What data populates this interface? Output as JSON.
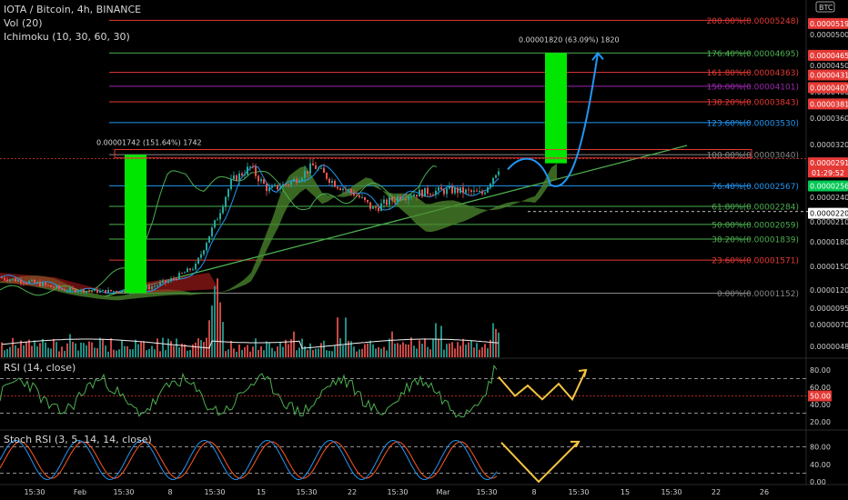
{
  "header": {
    "symbol": "IOTA / Bitcoin, 4h, BINANCE",
    "volume_indicator": "Vol (20)",
    "ichimoku_indicator": "Ichimoku (10, 30, 60, 30)",
    "currency_badge": "BTC"
  },
  "rsi_panel": {
    "label": "RSI (14, close)"
  },
  "stoch_panel": {
    "label": "Stoch RSI (3, 5, 14, 14, close)"
  },
  "annotations": {
    "left_measure": "0.00001742 (151.64%) 1742",
    "right_measure": "0.00001820 (63.09%) 1820"
  },
  "fib_levels": [
    {
      "label": "200.00%(0.00005248)",
      "value": 5.248e-05,
      "color": "#e53935"
    },
    {
      "label": "176.40%(0.00004695)",
      "value": 4.695e-05,
      "color": "#4caf50"
    },
    {
      "label": "161.80%(0.00004363)",
      "value": 4.363e-05,
      "color": "#e53935"
    },
    {
      "label": "150.00%(0.00004101)",
      "value": 4.101e-05,
      "color": "#9c27b0"
    },
    {
      "label": "138.20%(0.00003843)",
      "value": 3.843e-05,
      "color": "#e53935"
    },
    {
      "label": "123.60%(0.00003530)",
      "value": 3.53e-05,
      "color": "#2196f3"
    },
    {
      "label": "100.00%(0.00003040)",
      "value": 3.04e-05,
      "color": "#888888"
    },
    {
      "label": "76.40%(0.00002567)",
      "value": 2.567e-05,
      "color": "#2196f3"
    },
    {
      "label": "61.80%(0.00002284)",
      "value": 2.284e-05,
      "color": "#4caf50"
    },
    {
      "label": "50.00%(0.00002059)",
      "value": 2.059e-05,
      "color": "#4caf50"
    },
    {
      "label": "38.20%(0.00001839)",
      "value": 1.839e-05,
      "color": "#4caf50"
    },
    {
      "label": "23.60%(0.00001571)",
      "value": 1.571e-05,
      "color": "#e53935"
    },
    {
      "label": "0.00%(0.00001152)",
      "value": 1.152e-05,
      "color": "#888888"
    }
  ],
  "price_axis": {
    "ticks": [
      "0.00005000",
      "0.00004500",
      "0.00004000",
      "0.00003600",
      "0.00003200",
      "0.00002800",
      "0.00002400",
      "0.00002100",
      "0.00001800",
      "0.00001500",
      "0.00001200",
      "0.00000950",
      "0.00000700",
      "0.00000480"
    ],
    "tick_values": [
      5e-05,
      4.5e-05,
      4e-05,
      3.6e-05,
      3.2e-05,
      2.8e-05,
      2.4e-05,
      2.1e-05,
      1.8e-05,
      1.5e-05,
      1.2e-05,
      9.5e-06,
      7e-06,
      4.8e-06
    ],
    "badges": [
      {
        "text": "0.00005192",
        "value": 5.192e-05,
        "color": "#e53935"
      },
      {
        "text": "0.00004658",
        "value": 4.658e-05,
        "color": "#e53935"
      },
      {
        "text": "0.00004313",
        "value": 4.313e-05,
        "color": "#e53935"
      },
      {
        "text": "0.00004076",
        "value": 4.076e-05,
        "color": "#e53935"
      },
      {
        "text": "0.00003810",
        "value": 3.81e-05,
        "color": "#e53935"
      },
      {
        "text": "0.00002916",
        "value": 2.916e-05,
        "color": "#e53935"
      },
      {
        "text": "0.00002565",
        "value": 2.565e-05,
        "color": "#00c853"
      },
      {
        "text": "0.00002200",
        "value": 2.2e-05,
        "color": "#ffffff"
      }
    ],
    "countdown": "01:29:52"
  },
  "rsi_axis": {
    "ticks": [
      "80.00",
      "60.00",
      "40.00",
      "20.00"
    ],
    "tick_values": [
      80,
      60,
      40,
      20
    ],
    "badge": "50.00",
    "badge_value": 50
  },
  "stoch_axis": {
    "ticks": [
      "80.00",
      "40.00",
      "0.00"
    ],
    "tick_values": [
      80,
      40,
      0
    ]
  },
  "time_axis": {
    "labels": [
      "15:30",
      "Feb",
      "15:30",
      "8",
      "15:30",
      "15",
      "15:30",
      "22",
      "15:30",
      "Mar",
      "15:30",
      "8",
      "15:30",
      "15",
      "15:30",
      "22",
      "26"
    ]
  },
  "colors": {
    "background": "#000000",
    "bull": "#26a69a",
    "bear": "#ef5350",
    "target_box": "#00e600",
    "projection": "#2196f3",
    "rsi": "#4caf50",
    "stoch_k": "#2196f3",
    "stoch_d": "#ff5722",
    "projection_yellow": "#f5c542",
    "trendline": "#4caf50"
  }
}
